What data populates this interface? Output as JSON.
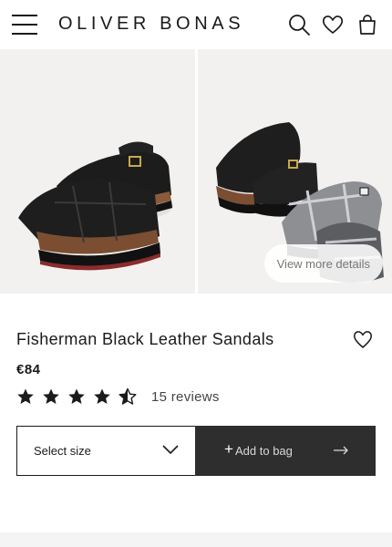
{
  "header": {
    "logo": "OLIVER BONAS",
    "icons": [
      "menu-icon",
      "search-icon",
      "heart-icon",
      "bag-icon"
    ]
  },
  "gallery": {
    "more_details": "View more details"
  },
  "product": {
    "title": "Fisherman Black Leather Sandals",
    "price": "€84",
    "rating": 4.5,
    "rating_max": 5,
    "reviews": "15 reviews"
  },
  "actions": {
    "size_placeholder": "Select size",
    "add_plus": "+",
    "add_label": "Add to bag"
  },
  "colors": {
    "text": "#1a1a1a",
    "button_dark": "#2e2e2e",
    "image_bg": "#f2f1ef"
  }
}
